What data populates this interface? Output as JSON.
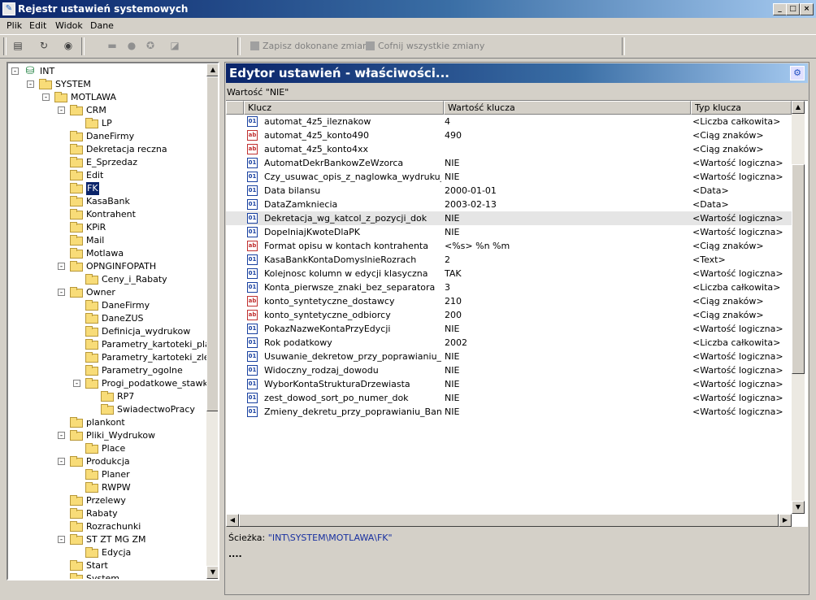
{
  "window": {
    "title": "Rejestr ustawień systemowych",
    "controls": [
      "_",
      "□",
      "×"
    ]
  },
  "menu": [
    "Plik",
    "Edit",
    "Widok",
    "Dane"
  ],
  "toolbar": {
    "save_label": "Zapisz dokonane zmiany",
    "revert_label": "Cofnij wszystkie zmiany"
  },
  "tree": [
    {
      "label": "INT",
      "level": 0,
      "expander": "-",
      "root": true
    },
    {
      "label": "SYSTEM",
      "level": 1,
      "expander": "-"
    },
    {
      "label": "MOTLAWA",
      "level": 2,
      "expander": "-"
    },
    {
      "label": "CRM",
      "level": 3,
      "expander": "-"
    },
    {
      "label": "LP",
      "level": 4,
      "expander": ""
    },
    {
      "label": "DaneFirmy",
      "level": 3,
      "expander": ""
    },
    {
      "label": "Dekretacja reczna",
      "level": 3,
      "expander": ""
    },
    {
      "label": "E_Sprzedaz",
      "level": 3,
      "expander": ""
    },
    {
      "label": "Edit",
      "level": 3,
      "expander": ""
    },
    {
      "label": "FK",
      "level": 3,
      "expander": "",
      "selected": true
    },
    {
      "label": "KasaBank",
      "level": 3,
      "expander": ""
    },
    {
      "label": "Kontrahent",
      "level": 3,
      "expander": ""
    },
    {
      "label": "KPiR",
      "level": 3,
      "expander": ""
    },
    {
      "label": "Mail",
      "level": 3,
      "expander": ""
    },
    {
      "label": "Motlawa",
      "level": 3,
      "expander": ""
    },
    {
      "label": "OPNGINFOPATH",
      "level": 3,
      "expander": "-"
    },
    {
      "label": "Ceny_i_Rabaty",
      "level": 4,
      "expander": ""
    },
    {
      "label": "Owner",
      "level": 3,
      "expander": "-"
    },
    {
      "label": "DaneFirmy",
      "level": 4,
      "expander": ""
    },
    {
      "label": "DaneZUS",
      "level": 4,
      "expander": ""
    },
    {
      "label": "Definicja_wydrukow",
      "level": 4,
      "expander": ""
    },
    {
      "label": "Parametry_kartoteki_plac",
      "level": 4,
      "expander": ""
    },
    {
      "label": "Parametry_kartoteki_zlece",
      "level": 4,
      "expander": ""
    },
    {
      "label": "Parametry_ogolne",
      "level": 4,
      "expander": ""
    },
    {
      "label": "Progi_podatkowe_stawki_z",
      "level": 4,
      "expander": "-"
    },
    {
      "label": "RP7",
      "level": 5,
      "expander": ""
    },
    {
      "label": "SwiadectwoPracy",
      "level": 5,
      "expander": ""
    },
    {
      "label": "plankont",
      "level": 3,
      "expander": ""
    },
    {
      "label": "Pliki_Wydrukow",
      "level": 3,
      "expander": "-"
    },
    {
      "label": "Place",
      "level": 4,
      "expander": ""
    },
    {
      "label": "Produkcja",
      "level": 3,
      "expander": "-"
    },
    {
      "label": "Planer",
      "level": 4,
      "expander": ""
    },
    {
      "label": "RWPW",
      "level": 4,
      "expander": ""
    },
    {
      "label": "Przelewy",
      "level": 3,
      "expander": ""
    },
    {
      "label": "Rabaty",
      "level": 3,
      "expander": ""
    },
    {
      "label": "Rozrachunki",
      "level": 3,
      "expander": ""
    },
    {
      "label": "ST ZT MG ZM",
      "level": 3,
      "expander": "-"
    },
    {
      "label": "Edycja",
      "level": 4,
      "expander": ""
    },
    {
      "label": "Start",
      "level": 3,
      "expander": ""
    },
    {
      "label": "System",
      "level": 3,
      "expander": ""
    }
  ],
  "editor": {
    "title": "Edytor ustawień - właściwości...",
    "value_label": "Wartość \"NIE\"",
    "columns": [
      "Klucz",
      "Wartość klucza",
      "Typ klucza"
    ],
    "rows": [
      {
        "key": "automat_4z5_ileznakow",
        "value": "4",
        "type": "<Liczba całkowita>",
        "icon": "num"
      },
      {
        "key": "automat_4z5_konto490",
        "value": "490",
        "type": "<Ciąg znaków>",
        "icon": "str"
      },
      {
        "key": "automat_4z5_konto4xx",
        "value": "",
        "type": "<Ciąg znaków>",
        "icon": "str"
      },
      {
        "key": "AutomatDekrBankowZeWzorca",
        "value": "NIE",
        "type": "<Wartość logiczna>",
        "icon": "num"
      },
      {
        "key": "Czy_usuwac_opis_z_naglowka_wydruku_PK",
        "value": "NIE",
        "type": "<Wartość logiczna>",
        "icon": "num"
      },
      {
        "key": "Data bilansu",
        "value": "2000-01-01",
        "type": "<Data>",
        "icon": "num"
      },
      {
        "key": "DataZamkniecia",
        "value": "2003-02-13",
        "type": "<Data>",
        "icon": "num"
      },
      {
        "key": "Dekretacja_wg_katcol_z_pozycji_dok",
        "value": "NIE",
        "type": "<Wartość logiczna>",
        "icon": "num",
        "highlight": true
      },
      {
        "key": "DopelniajKwoteDlaPK",
        "value": "NIE",
        "type": "<Wartość logiczna>",
        "icon": "num"
      },
      {
        "key": "Format opisu w kontach kontrahenta",
        "value": "<%s> %n %m",
        "type": "<Ciąg znaków>",
        "icon": "str"
      },
      {
        "key": "KasaBankKontaDomyslnieRozrach",
        "value": "2",
        "type": "<Text>",
        "icon": "num"
      },
      {
        "key": "Kolejnosc kolumn w edycji klasyczna",
        "value": "TAK",
        "type": "<Wartość logiczna>",
        "icon": "num"
      },
      {
        "key": "Konta_pierwsze_znaki_bez_separatora",
        "value": "3",
        "type": "<Liczba całkowita>",
        "icon": "num"
      },
      {
        "key": "konto_syntetyczne_dostawcy",
        "value": "210",
        "type": "<Ciąg znaków>",
        "icon": "str"
      },
      {
        "key": "konto_syntetyczne_odbiorcy",
        "value": "200",
        "type": "<Ciąg znaków>",
        "icon": "str"
      },
      {
        "key": "PokazNazweKontaPrzyEdycji",
        "value": "NIE",
        "type": "<Wartość logiczna>",
        "icon": "num"
      },
      {
        "key": "Rok podatkowy",
        "value": "2002",
        "type": "<Liczba całkowita>",
        "icon": "num"
      },
      {
        "key": "Usuwanie_dekretow_przy_poprawianiu_Ba...",
        "value": "NIE",
        "type": "<Wartość logiczna>",
        "icon": "num"
      },
      {
        "key": "Widoczny_rodzaj_dowodu",
        "value": "NIE",
        "type": "<Wartość logiczna>",
        "icon": "num"
      },
      {
        "key": "WyborKontaStrukturaDrzewiasta",
        "value": "NIE",
        "type": "<Wartość logiczna>",
        "icon": "num"
      },
      {
        "key": "zest_dowod_sort_po_numer_dok",
        "value": "NIE",
        "type": "<Wartość logiczna>",
        "icon": "num"
      },
      {
        "key": "Zmieny_dekretu_przy_poprawianiu_Banku...",
        "value": "NIE",
        "type": "<Wartość logiczna>",
        "icon": "num"
      }
    ],
    "path_label": "Ścieżka:",
    "path_value": "\"INT\\SYSTEM\\MOTLAWA\\FK\"",
    "dots": "...."
  },
  "colors": {
    "titlebar": "#0a246a",
    "highlight_row": "#e5e5e5",
    "selected": "#0a246a"
  }
}
